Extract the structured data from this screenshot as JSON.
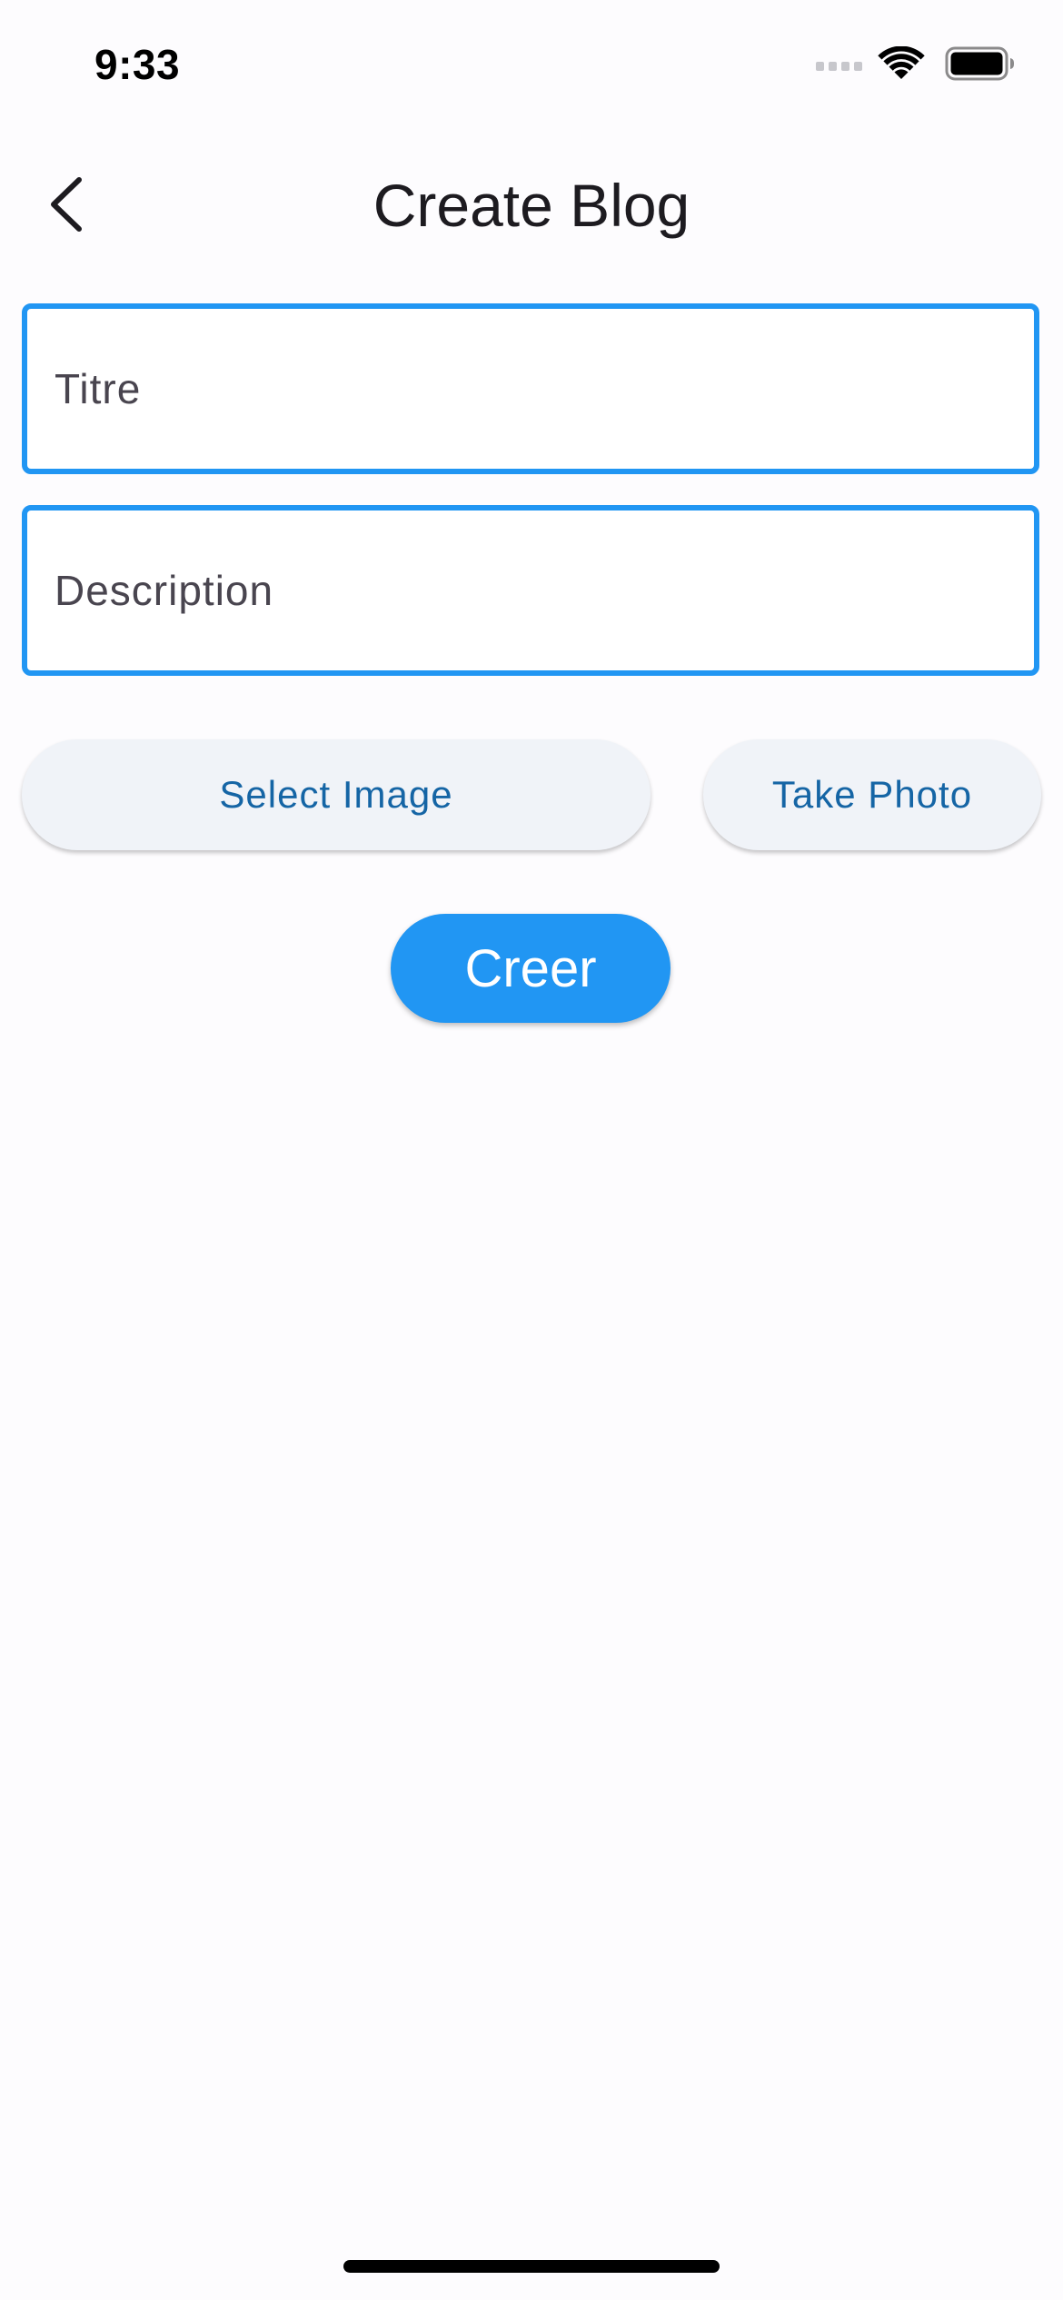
{
  "status_bar": {
    "time": "9:33",
    "icons": [
      "signal-icon",
      "wifi-icon",
      "battery-icon"
    ]
  },
  "app_bar": {
    "back_icon": "chevron-left-icon",
    "title": "Create Blog"
  },
  "form": {
    "title_field": {
      "placeholder": "Titre",
      "value": ""
    },
    "description_field": {
      "placeholder": "Description",
      "value": ""
    },
    "select_image_label": "Select Image",
    "take_photo_label": "Take Photo",
    "create_label": "Creer"
  },
  "colors": {
    "accent": "#2196f3",
    "tonal_button_bg": "#f0f3f8",
    "tonal_button_text": "#1565a5",
    "background": "#fdfcfe"
  }
}
